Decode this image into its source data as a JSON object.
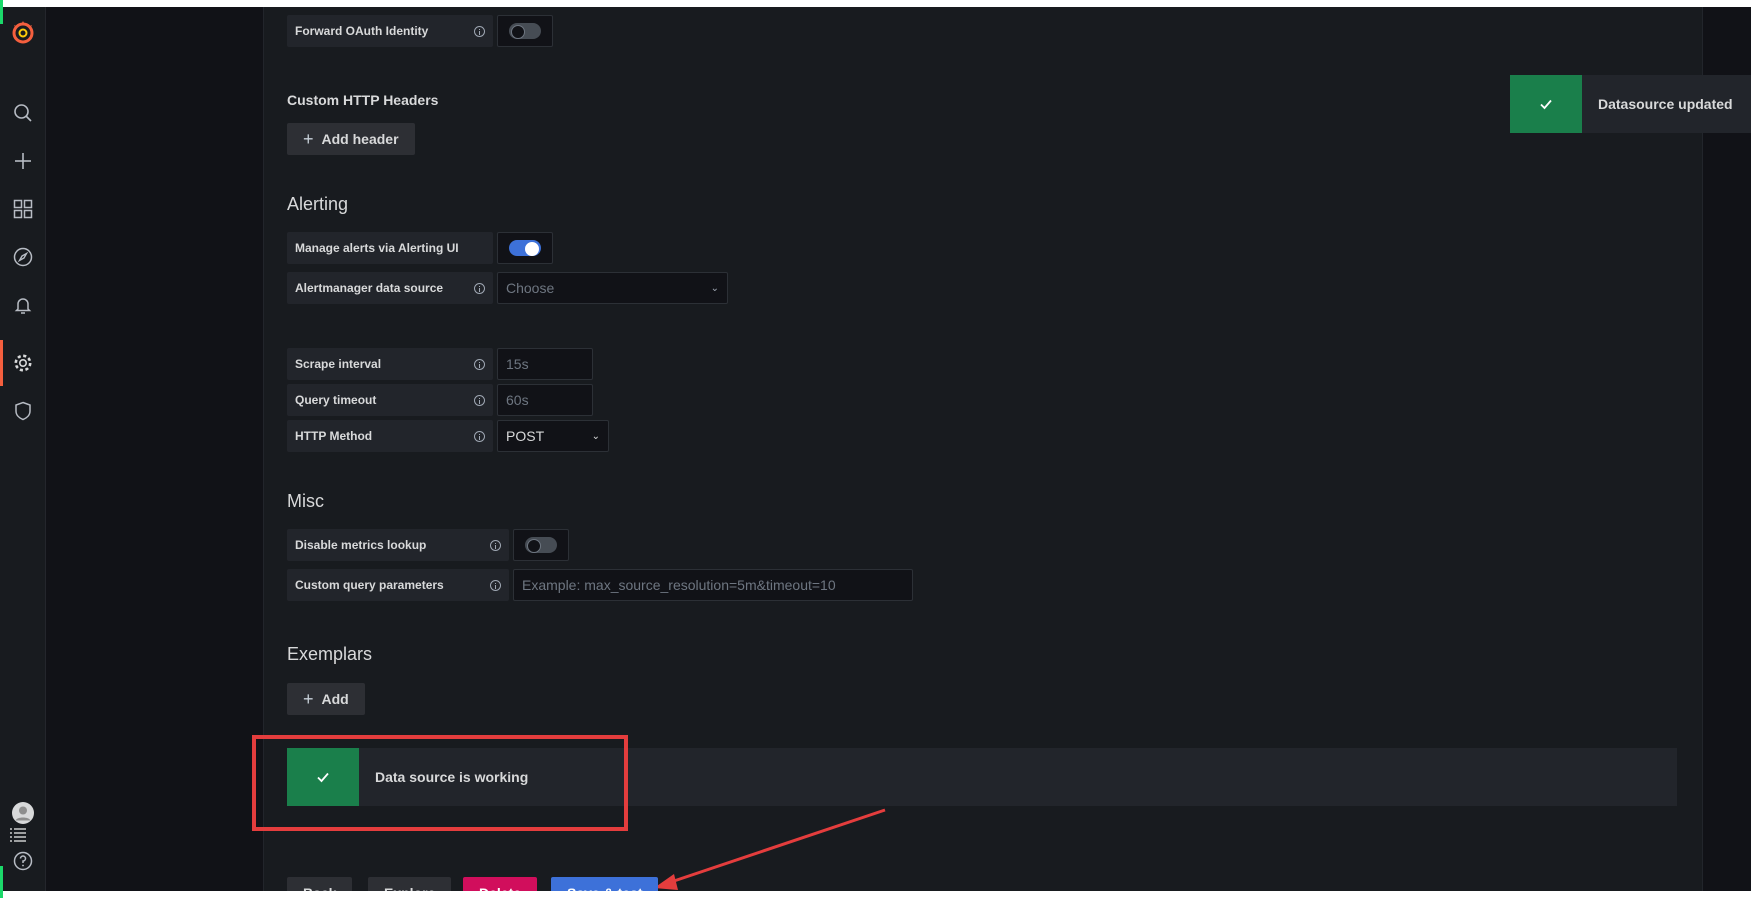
{
  "sidebar": {
    "logo": "grafana-logo-icon",
    "items": [
      {
        "icon": "search-icon"
      },
      {
        "icon": "plus-icon"
      },
      {
        "icon": "dashboards-icon"
      },
      {
        "icon": "explore-compass-icon"
      },
      {
        "icon": "alerting-bell-icon"
      },
      {
        "icon": "configuration-gear-icon",
        "active": true
      },
      {
        "icon": "shield-icon"
      }
    ],
    "bottom": [
      {
        "icon": "avatar-icon"
      },
      {
        "icon": "list-icon"
      },
      {
        "icon": "help-icon"
      }
    ]
  },
  "forward_oauth": {
    "label": "Forward OAuth Identity",
    "enabled": false
  },
  "custom_headers": {
    "title": "Custom HTTP Headers",
    "add_label": "Add header"
  },
  "alerting": {
    "title": "Alerting",
    "manage_label": "Manage alerts via Alerting UI",
    "manage_enabled": true,
    "alertmanager_label": "Alertmanager data source",
    "alertmanager_placeholder": "Choose"
  },
  "prometheus": {
    "scrape_label": "Scrape interval",
    "scrape_placeholder": "15s",
    "timeout_label": "Query timeout",
    "timeout_placeholder": "60s",
    "method_label": "HTTP Method",
    "method_value": "POST"
  },
  "misc": {
    "title": "Misc",
    "disable_metrics_label": "Disable metrics lookup",
    "disable_metrics_enabled": false,
    "custom_query_label": "Custom query parameters",
    "custom_query_placeholder": "Example: max_source_resolution=5m&timeout=10"
  },
  "exemplars": {
    "title": "Exemplars",
    "add_label": "Add"
  },
  "status": {
    "message": "Data source is working"
  },
  "toast": {
    "message": "Datasource updated"
  },
  "actions": {
    "back": "Back",
    "explore": "Explore",
    "delete": "Delete",
    "save": "Save & test"
  },
  "colors": {
    "background": "#111217",
    "panel": "#181b1f",
    "success": "#1a7f4b",
    "primary": "#3d71d9",
    "danger": "#d10e5c",
    "annotation_red": "#e43d3d",
    "grafana_orange": "#f55f3e"
  }
}
